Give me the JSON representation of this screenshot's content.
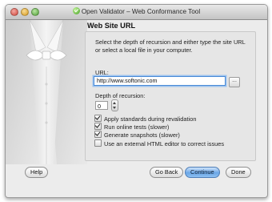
{
  "window": {
    "title": "Open Validator – Web Conformance Tool",
    "app_icon": "green-check-circle-icon"
  },
  "page": {
    "heading": "Web Site URL",
    "description": "Select the depth of recursion and either type the site URL or select a local file in your computer."
  },
  "url_field": {
    "label": "URL:",
    "value": "http://www.softonic.com",
    "browse_label": "..."
  },
  "depth_field": {
    "label": "Depth of recursion:",
    "value": "0"
  },
  "options": [
    {
      "label": "Apply standards during revalidation",
      "checked": true
    },
    {
      "label": "Run online tests (slower)",
      "checked": true
    },
    {
      "label": "Generate snapshots (slower)",
      "checked": true
    },
    {
      "label": "Use an external HTML editor to correct issues",
      "checked": false
    }
  ],
  "buttons": {
    "help": "Help",
    "go_back": "Go Back",
    "continue": "Continue",
    "done": "Done"
  },
  "colors": {
    "focus_ring": "#4a8ad6",
    "primary_button": "#6aa6e6"
  }
}
